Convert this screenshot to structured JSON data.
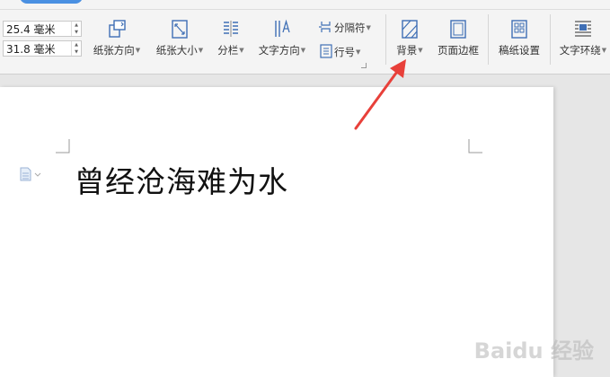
{
  "margins": {
    "top_value": "25.4 毫米",
    "bottom_value": "31.8 毫米"
  },
  "toolbar": {
    "orientation": "纸张方向",
    "size": "纸张大小",
    "columns": "分栏",
    "text_direction": "文字方向",
    "breaks": "分隔符",
    "line_numbers": "行号",
    "background": "背景",
    "page_border": "页面边框",
    "manuscript": "稿纸设置",
    "text_wrap": "文字环绕"
  },
  "document": {
    "text": "曾经沧海难为水"
  },
  "watermark": {
    "text": "Baidu 经验"
  },
  "colors": {
    "accent": "#4a90e2",
    "arrow": "#e8403a",
    "icon_blue": "#3f6fb5"
  }
}
